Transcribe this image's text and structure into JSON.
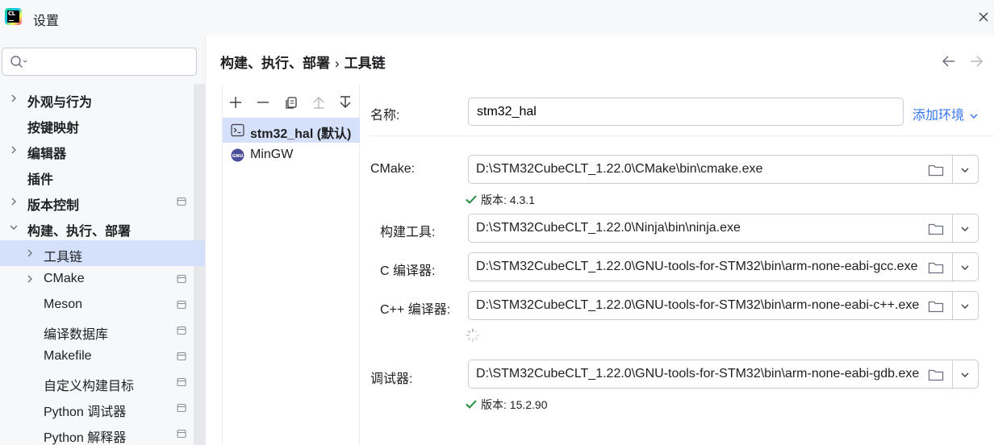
{
  "window": {
    "title": "设置"
  },
  "search": {
    "placeholder": "",
    "value": ""
  },
  "sidebar": {
    "items": [
      {
        "label": "外观与行为",
        "bold": true,
        "expandable": true,
        "level": 0,
        "project": false
      },
      {
        "label": "按键映射",
        "bold": true,
        "expandable": false,
        "level": 0,
        "project": false
      },
      {
        "label": "编辑器",
        "bold": true,
        "expandable": true,
        "level": 0,
        "project": false
      },
      {
        "label": "插件",
        "bold": true,
        "expandable": false,
        "level": 0,
        "project": false
      },
      {
        "label": "版本控制",
        "bold": true,
        "expandable": true,
        "level": 0,
        "project": true
      },
      {
        "label": "构建、执行、部署",
        "bold": true,
        "expandable": true,
        "expanded": true,
        "level": 0,
        "project": false
      },
      {
        "label": "工具链",
        "bold": false,
        "expandable": true,
        "level": 1,
        "project": false,
        "selected": true
      },
      {
        "label": "CMake",
        "bold": false,
        "expandable": true,
        "level": 1,
        "project": true
      },
      {
        "label": "Meson",
        "bold": false,
        "expandable": false,
        "level": 1,
        "project": true
      },
      {
        "label": "编译数据库",
        "bold": false,
        "expandable": false,
        "level": 1,
        "project": true
      },
      {
        "label": "Makefile",
        "bold": false,
        "expandable": false,
        "level": 1,
        "project": true
      },
      {
        "label": "自定义构建目标",
        "bold": false,
        "expandable": false,
        "level": 1,
        "project": true
      },
      {
        "label": "Python 调试器",
        "bold": false,
        "expandable": false,
        "level": 1,
        "project": true
      },
      {
        "label": "Python 解释器",
        "bold": false,
        "expandable": false,
        "level": 1,
        "project": true
      }
    ]
  },
  "breadcrumb": {
    "parent": "构建、执行、部署",
    "separator": "›",
    "current": "工具链"
  },
  "toolchains": {
    "items": [
      {
        "name": "stm32_hal (默认)",
        "icon": "terminal-icon",
        "selected": true
      },
      {
        "name": "MinGW",
        "icon": "gnu-icon",
        "selected": false
      }
    ]
  },
  "form": {
    "name_label": "名称:",
    "name_value": "stm32_hal",
    "add_env": "添加环境",
    "cmake_label": "CMake:",
    "cmake_path": "D:\\STM32CubeCLT_1.22.0\\CMake\\bin\\cmake.exe",
    "cmake_version": "版本: 4.3.1",
    "build_tool_label": "构建工具:",
    "build_tool_path": "D:\\STM32CubeCLT_1.22.0\\Ninja\\bin\\ninja.exe",
    "c_compiler_label": "C 编译器:",
    "c_compiler_path": "D:\\STM32CubeCLT_1.22.0\\GNU-tools-for-STM32\\bin\\arm-none-eabi-gcc.exe",
    "cpp_compiler_label": "C++ 编译器:",
    "cpp_compiler_path": "D:\\STM32CubeCLT_1.22.0\\GNU-tools-for-STM32\\bin\\arm-none-eabi-c++.exe",
    "debugger_label": "调试器:",
    "debugger_path": "D:\\STM32CubeCLT_1.22.0\\GNU-tools-for-STM32\\bin\\arm-none-eabi-gdb.exe",
    "debugger_version": "版本: 15.2.90"
  },
  "colors": {
    "accent": "#3574f0",
    "selection": "#d5e1fb",
    "check": "#208a3c"
  }
}
